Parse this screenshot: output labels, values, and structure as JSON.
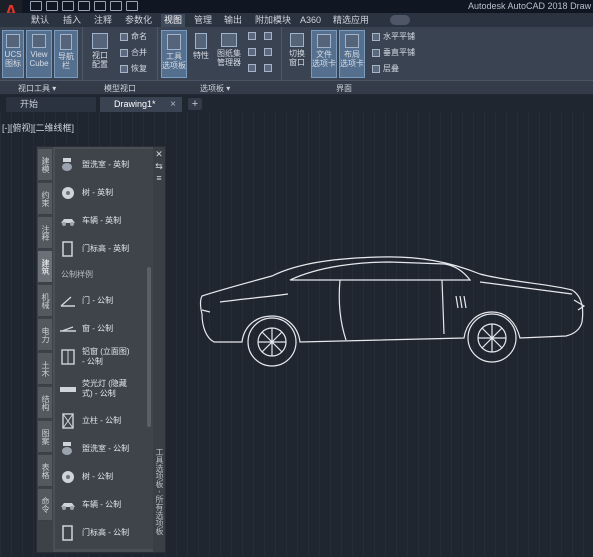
{
  "app": {
    "logo": "A",
    "title": "Autodesk AutoCAD 2018   Draw"
  },
  "menu": {
    "tabs": [
      {
        "label": "默认"
      },
      {
        "label": "插入"
      },
      {
        "label": "注释"
      },
      {
        "label": "参数化"
      },
      {
        "label": "视图"
      },
      {
        "label": "管理"
      },
      {
        "label": "输出"
      },
      {
        "label": "附加模块"
      },
      {
        "label": "A360"
      },
      {
        "label": "精选应用"
      }
    ],
    "active_index": 4
  },
  "ribbon": {
    "buttons": {
      "ucs": "UCS\n图标",
      "viewcube": "View\nCube",
      "navbar": "导航栏",
      "viewport_config": "视口\n配置",
      "tool_palettes": "工具\n选项板",
      "properties": "特性",
      "sheet_set": "图纸集\n管理器",
      "switch_window": "切换\n窗口",
      "file_tabs": "文件\n选项卡",
      "layout_tabs": "布局\n选项卡"
    },
    "small": {
      "name": "命名",
      "join": "合并",
      "restore": "恢复",
      "tile_h": "水平平铺",
      "tile_v": "垂直平铺",
      "cascade": "层叠"
    },
    "panels": {
      "viewport_tools": "视口工具 ▾",
      "model_viewports": "模型视口",
      "palettes": "选项板 ▾",
      "interface": "界面"
    }
  },
  "file_tabs": {
    "start": "开始",
    "drawing": "Drawing1*",
    "close": "×",
    "plus": "+"
  },
  "viewport_label": "[-][俯视][二维线框]",
  "palette": {
    "tabs": [
      "建模",
      "约束",
      "注释",
      "建筑",
      "机械",
      "电力",
      "土木",
      "结构",
      "图案",
      "表格",
      "命令"
    ],
    "active_tab": 3,
    "items_imperial": [
      {
        "label": "盥洗室 - 英制",
        "icon": "toilet-icon"
      },
      {
        "label": "树 - 英制",
        "icon": "tree-icon"
      },
      {
        "label": "车辆 - 英制",
        "icon": "car-icon"
      },
      {
        "label": "门标高 - 英制",
        "icon": "door-elevation-icon"
      }
    ],
    "section": "公制样例",
    "items_metric": [
      {
        "label": "门 - 公制",
        "icon": "door-icon"
      },
      {
        "label": "窗 - 公制",
        "icon": "window-icon"
      },
      {
        "label": "铝窗 (立面图)\n- 公制",
        "icon": "aluminum-window-icon"
      },
      {
        "label": "荧光灯 (隐藏\n式) - 公制",
        "icon": "fluorescent-light-icon"
      },
      {
        "label": "立柱 - 公制",
        "icon": "column-icon"
      },
      {
        "label": "盥洗室 - 公制",
        "icon": "toilet-icon"
      },
      {
        "label": "树 - 公制",
        "icon": "tree-icon"
      },
      {
        "label": "车辆 - 公制",
        "icon": "car-icon"
      },
      {
        "label": "门标高 - 公制",
        "icon": "door-elevation-icon"
      }
    ],
    "side": {
      "close": "✕",
      "autohide": "⇆",
      "properties": "≡",
      "title": "工具选项板 - 所有选项板"
    }
  }
}
